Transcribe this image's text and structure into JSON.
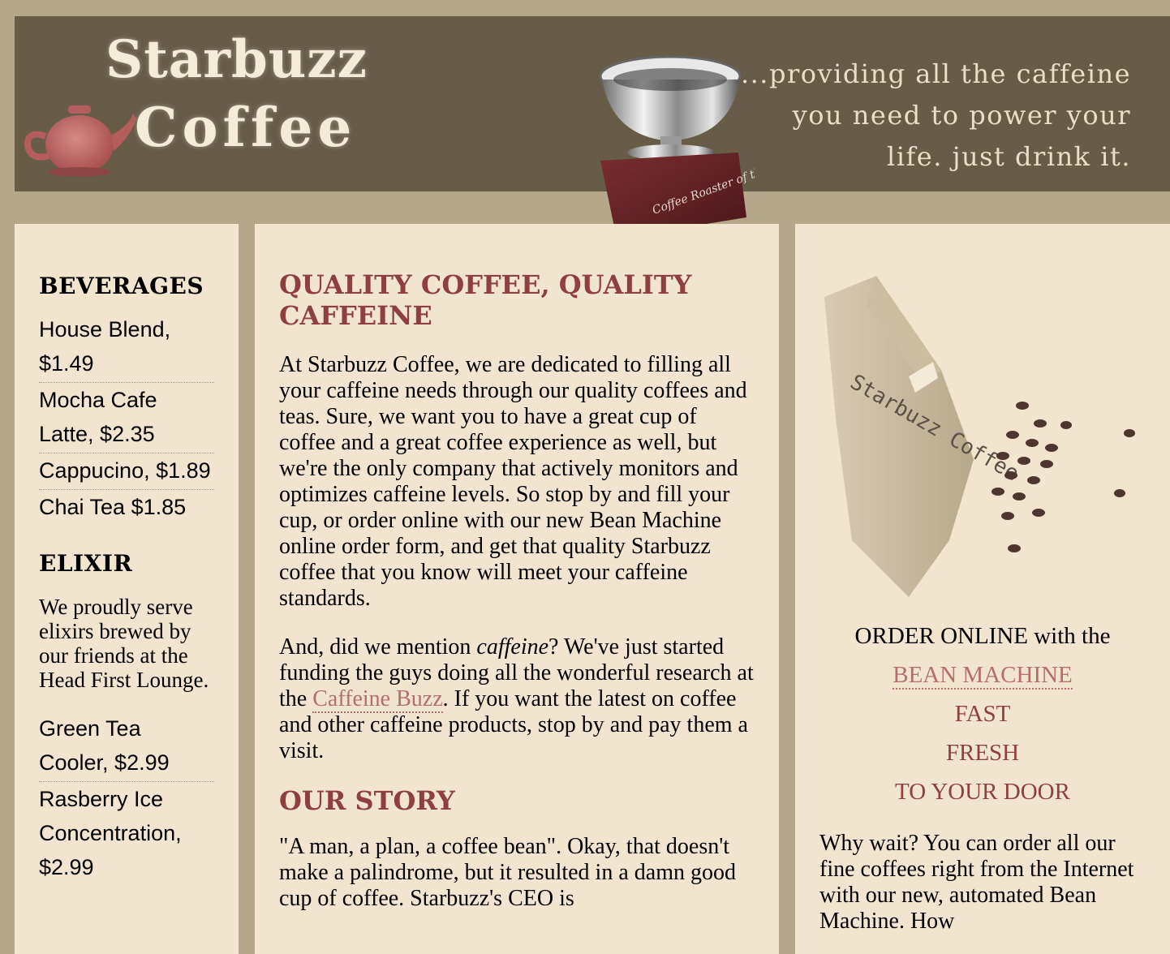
{
  "header": {
    "logo_line1": "Starbuzz",
    "logo_line2": "Coffee",
    "tagline": "...providing all the caffeine\nyou need to power your\nlife. just drink it.",
    "trophy_text": "Coffee Roaster of the Year"
  },
  "sidebar": {
    "beverages_title": "BEVERAGES",
    "beverages": [
      "House Blend, $1.49",
      "Mocha Cafe Latte, $2.35",
      "Cappucino, $1.89",
      "Chai Tea $1.85"
    ],
    "elixir_title": "ELIXIR",
    "elixir_text": "We proudly serve elixirs brewed by our friends at the Head First Lounge.",
    "elixirs": [
      "Green Tea Cooler, $2.99",
      "Rasberry Ice Concentration, $2.99"
    ]
  },
  "main": {
    "title": "QUALITY COFFEE, QUALITY CAFFEINE",
    "p1": "At Starbuzz Coffee, we are dedicated to filling all your caffeine needs through our quality coffees and teas. Sure, we want you to have a great cup of coffee and a great coffee experience as well, but we're the only company that actively monitors and optimizes caffeine levels. So stop by and fill your cup, or order online with our new Bean Machine online order form, and get that quality Starbuzz coffee that you know will meet your caffeine standards.",
    "p2_before": "And, did we mention ",
    "p2_em": "caffeine",
    "p2_mid": "? We've just started funding the guys doing all the wonderful research at the ",
    "p2_link": "Caffeine Buzz",
    "p2_after": ". If you want the latest on coffee and other caffeine products, stop by and pay them a visit.",
    "story_title": "OUR STORY",
    "p3": "\"A man, a plan, a coffee bean\". Okay, that doesn't make a palindrome, but it resulted in a damn good cup of coffee. Starbuzz's CEO is"
  },
  "extras": {
    "bag_label": "Starbuzz Coffee",
    "order_intro": "ORDER ONLINE with the",
    "bean_machine_link": "BEAN MACHINE",
    "fast": "FAST",
    "fresh": "FRESH",
    "door": "TO YOUR DOOR",
    "why_text": "Why wait? You can order all our fine coffees right from the Internet with our new, automated Bean Machine. How"
  }
}
